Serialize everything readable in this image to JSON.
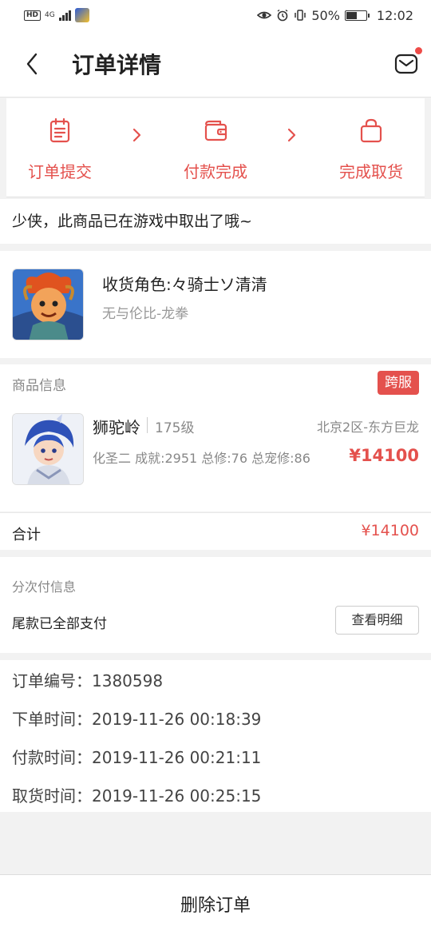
{
  "status_bar": {
    "network": "4G",
    "battery": "50%",
    "time": "12:02"
  },
  "header": {
    "title": "订单详情"
  },
  "steps": [
    {
      "label": "订单提交",
      "icon": "clipboard-icon"
    },
    {
      "label": "付款完成",
      "icon": "wallet-icon"
    },
    {
      "label": "完成取货",
      "icon": "bag-icon"
    }
  ],
  "notice": "少侠，此商品已在游戏中取出了哦~",
  "receiver": {
    "role": "收货角色:々骑士ソ清清",
    "server": "无与伦比-龙拳"
  },
  "goods": {
    "section_title": "商品信息",
    "badge": "跨服",
    "sect": "狮驼岭",
    "level": "175级",
    "area": "北京2区-东方巨龙",
    "attributes": "化圣二 成就:2951 总修:76 总宠修:86",
    "price": "¥14100"
  },
  "total": {
    "label": "合计",
    "value": "¥14100"
  },
  "installment": {
    "title": "分次付信息",
    "status": "尾款已全部支付",
    "detail_button": "查看明细"
  },
  "order_info": {
    "order_no": "订单编号：1380598",
    "placed": "下单时间：2019-11-26 00:18:39",
    "paid": "付款时间：2019-11-26 00:21:11",
    "picked": "取货时间：2019-11-26 00:25:15"
  },
  "bottom": {
    "delete_button": "删除订单"
  },
  "colors": {
    "accent": "#e4514d",
    "background": "#f2f2f2"
  }
}
